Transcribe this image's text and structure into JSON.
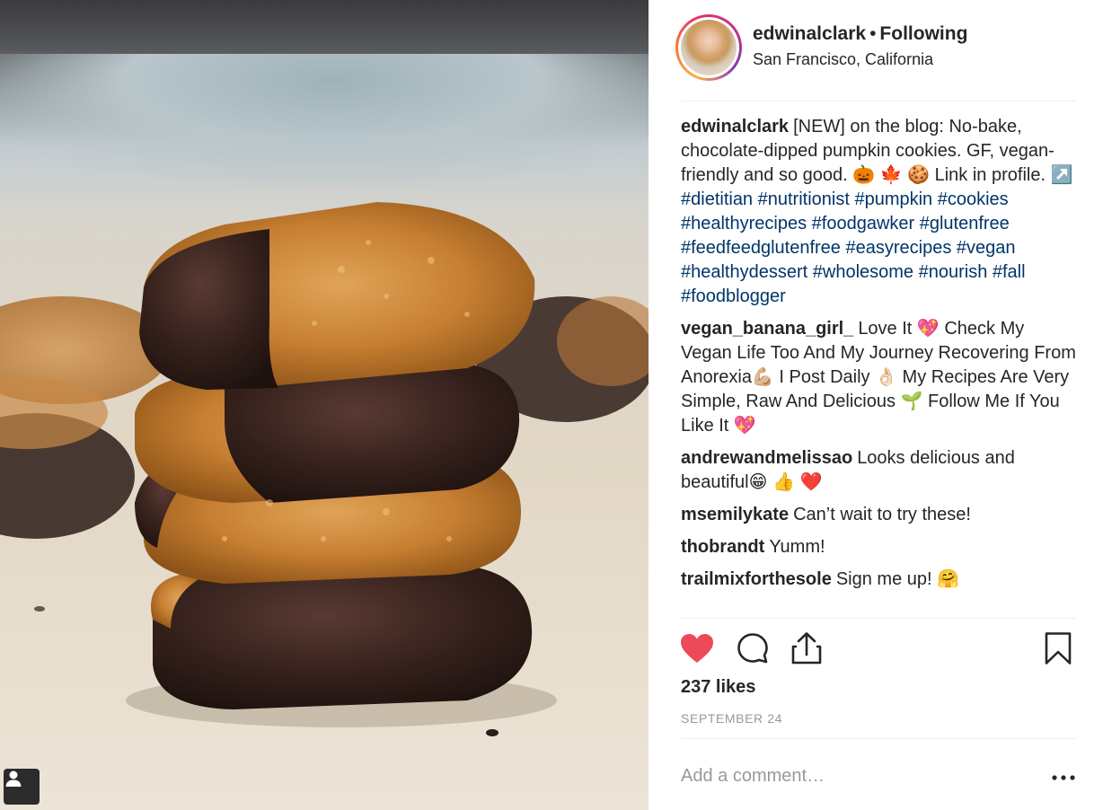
{
  "post": {
    "username": "edwinalclark",
    "separator": "•",
    "follow_status": "Following",
    "location": "San Francisco, California"
  },
  "caption": {
    "username": "edwinalclark",
    "text": "[NEW] on the blog: No-bake, chocolate-dipped pumpkin cookies. GF, vegan-friendly and so good. 🎃 🍁 🍪  Link in profile. ↗️ ",
    "hashtags": "#dietitian #nutritionist #pumpkin #cookies #healthyrecipes #foodgawker #glutenfree #feedfeedglutenfree #easyrecipes #vegan #healthydessert #wholesome #nourish #fall #foodblogger"
  },
  "comments": [
    {
      "username": "vegan_banana_girl_",
      "text": "Love It 💖  Check My Vegan Life Too And My Journey Recovering From Anorexia💪🏼  I Post Daily 👌🏻  My Recipes Are Very Simple, Raw And Delicious 🌱  Follow Me If You Like It 💖"
    },
    {
      "username": "andrewandmelissao",
      "text": "Looks delicious and beautiful😁 👍 ❤️"
    },
    {
      "username": "msemilykate",
      "text": "Can’t wait to try these!"
    },
    {
      "username": "thobrandt",
      "text": "Yumm!"
    },
    {
      "username": "trailmixforthesole",
      "text": "Sign me up! 🤗"
    }
  ],
  "actions": {
    "like_icon": "heart-filled-icon",
    "comment_icon": "comment-bubble-icon",
    "share_icon": "share-upload-icon",
    "save_icon": "bookmark-icon",
    "like_color": "#ed4956"
  },
  "likes": "237 likes",
  "date": "SEPTEMBER 24",
  "add_comment": {
    "placeholder": "Add a comment…",
    "more_label": "•••"
  },
  "photo": {
    "alt": "stack of chocolate-dipped pumpkin cookies",
    "user_tag_icon": "user-tag-icon"
  }
}
